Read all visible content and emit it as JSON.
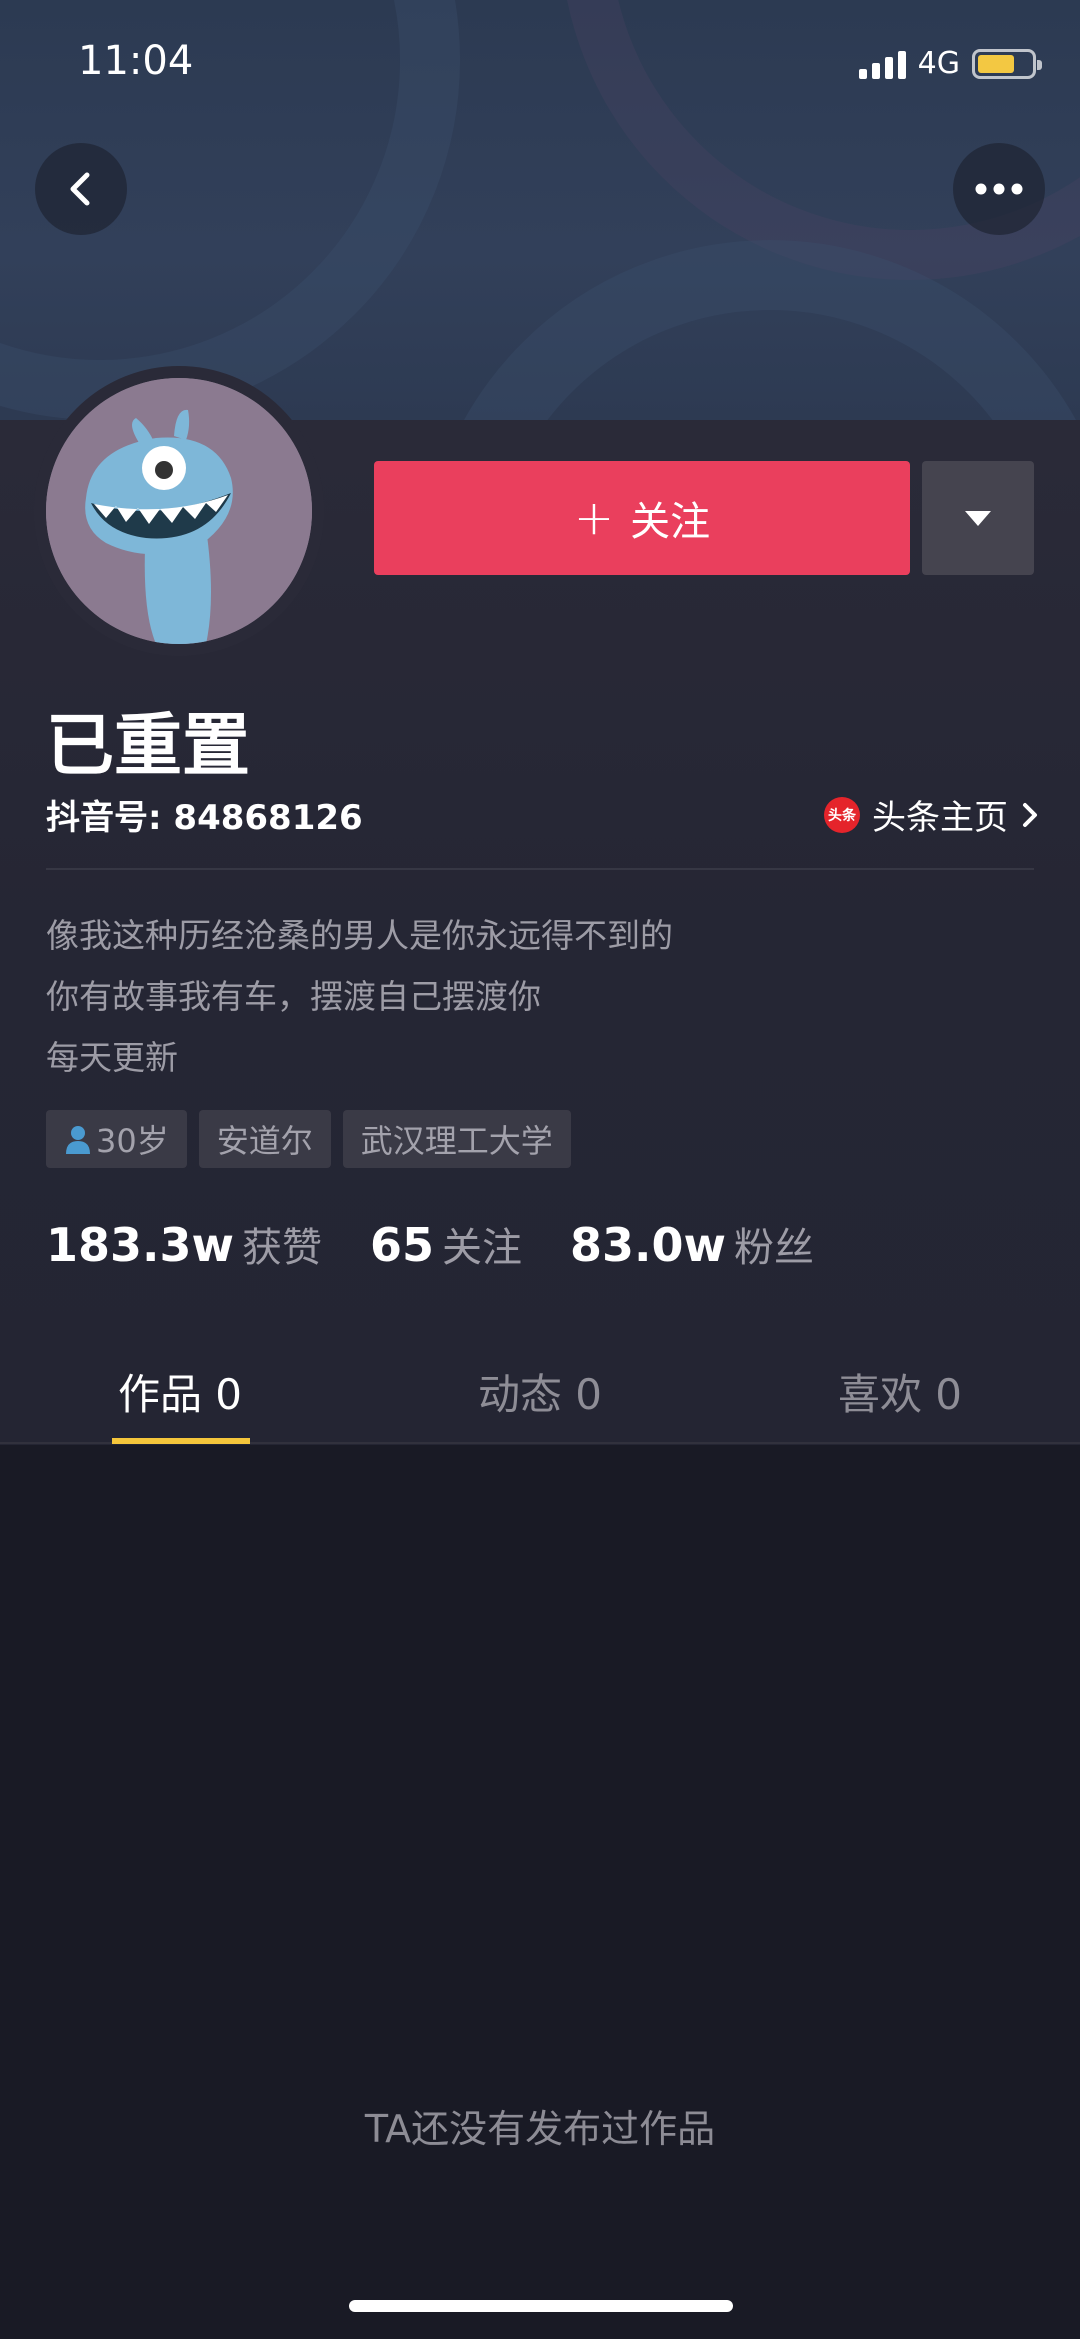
{
  "status_bar": {
    "time": "11:04",
    "network": "4G"
  },
  "profile": {
    "name": "已重置",
    "uid": "抖音号: 84868126",
    "toutiao_badge": "头条",
    "toutiao_label": "头条主页",
    "follow_label": "关注",
    "bio": [
      "像我这种历经沧桑的男人是你永远得不到的",
      "你有故事我有车，摆渡自己摆渡你",
      "每天更新"
    ],
    "tags": [
      "30岁",
      "安道尔",
      "武汉理工大学"
    ],
    "stats": [
      {
        "value": "183.3w",
        "label": "获赞"
      },
      {
        "value": "65",
        "label": "关注"
      },
      {
        "value": "83.0w",
        "label": "粉丝"
      }
    ]
  },
  "tabs": [
    {
      "label": "作品 0",
      "active": true
    },
    {
      "label": "动态 0",
      "active": false
    },
    {
      "label": "喜欢 0",
      "active": false
    }
  ],
  "empty_message": "TA还没有发布过作品",
  "colors": {
    "accent": "#ea3f5d",
    "tab_indicator": "#f5c63b",
    "background": "#191a25"
  }
}
